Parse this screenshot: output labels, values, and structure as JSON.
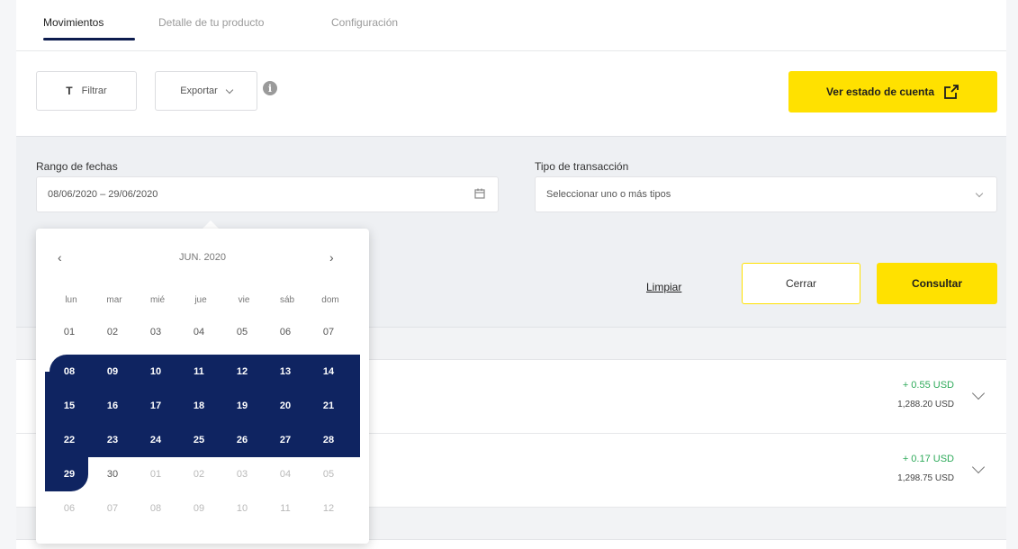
{
  "tabs": [
    {
      "label": "Movimientos",
      "active": true
    },
    {
      "label": "Detalle de tu producto",
      "active": false
    },
    {
      "label": "Configuración",
      "active": false
    }
  ],
  "toolbar": {
    "filter_label": "Filtrar",
    "export_label": "Exportar",
    "info_icon": "i",
    "statement_label": "Ver estado de cuenta",
    "statement_icon": "external-link-icon"
  },
  "filters": {
    "date_range_label": "Rango de fechas",
    "date_range_value": "08/06/2020 – 29/06/2020",
    "transaction_type_label": "Tipo de transacción",
    "transaction_type_placeholder": "Seleccionar uno o más tipos",
    "clear_label": "Limpiar",
    "close_label": "Cerrar",
    "query_label": "Consultar"
  },
  "movements": [
    {
      "amount": "+ 0.55 USD",
      "balance": "1,288.20 USD"
    },
    {
      "amount": "+ 0.17 USD",
      "balance": "1,298.75 USD"
    }
  ],
  "calendar": {
    "month_label": "JUN. 2020",
    "prev": "‹",
    "next": "›",
    "weekdays": [
      "lun",
      "mar",
      "mié",
      "jue",
      "vie",
      "sáb",
      "dom"
    ],
    "weeks": [
      [
        "01",
        "02",
        "03",
        "04",
        "05",
        "06",
        "07"
      ],
      [
        "08",
        "09",
        "10",
        "11",
        "12",
        "13",
        "14"
      ],
      [
        "15",
        "16",
        "17",
        "18",
        "19",
        "20",
        "21"
      ],
      [
        "22",
        "23",
        "24",
        "25",
        "26",
        "27",
        "28"
      ],
      [
        "29",
        "30",
        "01",
        "02",
        "03",
        "04",
        "05"
      ],
      [
        "06",
        "07",
        "08",
        "09",
        "10",
        "11",
        "12"
      ]
    ],
    "range_start": "08",
    "range_end": "29"
  },
  "colors": {
    "accent_yellow": "#ffe100",
    "range_navy": "#0f2461",
    "positive_green": "#2eaa5a"
  }
}
